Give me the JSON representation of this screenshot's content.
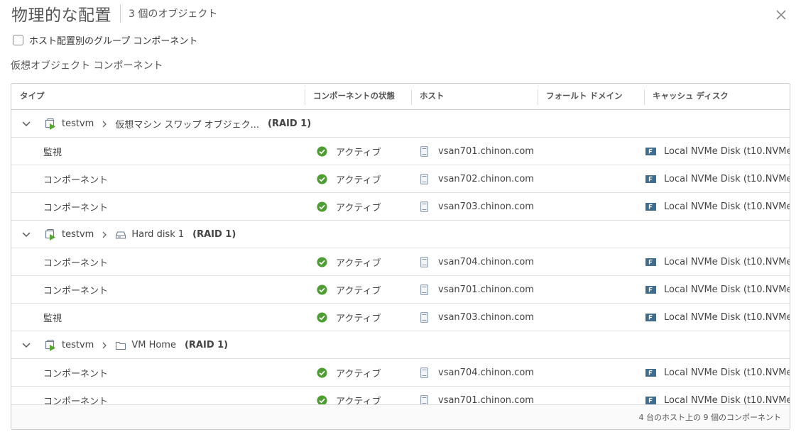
{
  "dialog": {
    "title": "物理的な配置",
    "object_count": "3 個のオブジェクト",
    "group_by_host_label": "ホスト配置別のグループ コンポーネント",
    "group_by_host_checked": false,
    "section_label": "仮想オブジェクト コンポーネント"
  },
  "table": {
    "columns": [
      "タイプ",
      "コンポーネントの状態",
      "ホスト",
      "フォールト ドメイン",
      "キャッシュ ディスク"
    ],
    "groups": [
      {
        "vm": "testvm",
        "object": "仮想マシン スワップ オブジェク...",
        "object_icon": "swap-object-icon",
        "raid": "(RAID 1)",
        "rows": [
          {
            "type": "監視",
            "state": "アクティブ",
            "host": "vsan701.chinon.com",
            "fault_domain": "",
            "cache_disk": "Local NVMe Disk (t10.NVMe_"
          },
          {
            "type": "コンポーネント",
            "state": "アクティブ",
            "host": "vsan702.chinon.com",
            "fault_domain": "",
            "cache_disk": "Local NVMe Disk (t10.NVMe_"
          },
          {
            "type": "コンポーネント",
            "state": "アクティブ",
            "host": "vsan703.chinon.com",
            "fault_domain": "",
            "cache_disk": "Local NVMe Disk (t10.NVMe_"
          }
        ]
      },
      {
        "vm": "testvm",
        "object": "Hard disk 1",
        "object_icon": "hard-disk-icon",
        "raid": "(RAID 1)",
        "rows": [
          {
            "type": "コンポーネント",
            "state": "アクティブ",
            "host": "vsan704.chinon.com",
            "fault_domain": "",
            "cache_disk": "Local NVMe Disk (t10.NVMe_"
          },
          {
            "type": "コンポーネント",
            "state": "アクティブ",
            "host": "vsan701.chinon.com",
            "fault_domain": "",
            "cache_disk": "Local NVMe Disk (t10.NVMe_"
          },
          {
            "type": "監視",
            "state": "アクティブ",
            "host": "vsan703.chinon.com",
            "fault_domain": "",
            "cache_disk": "Local NVMe Disk (t10.NVMe_"
          }
        ]
      },
      {
        "vm": "testvm",
        "object": "VM Home",
        "object_icon": "folder-icon",
        "raid": "(RAID 1)",
        "rows": [
          {
            "type": "コンポーネント",
            "state": "アクティブ",
            "host": "vsan704.chinon.com",
            "fault_domain": "",
            "cache_disk": "Local NVMe Disk (t10.NVMe_"
          },
          {
            "type": "コンポーネント",
            "state": "アクティブ",
            "host": "vsan701.chinon.com",
            "fault_domain": "",
            "cache_disk": "Local NVMe Disk (t10.NVMe_"
          }
        ]
      }
    ],
    "footer": "4 台のホスト上の 9 個のコンポーネント"
  },
  "colors": {
    "status_ok": "#4b9e2f",
    "vm_play": "#57a632",
    "disk_badge": "#3f6d90",
    "border": "#cccccc"
  }
}
